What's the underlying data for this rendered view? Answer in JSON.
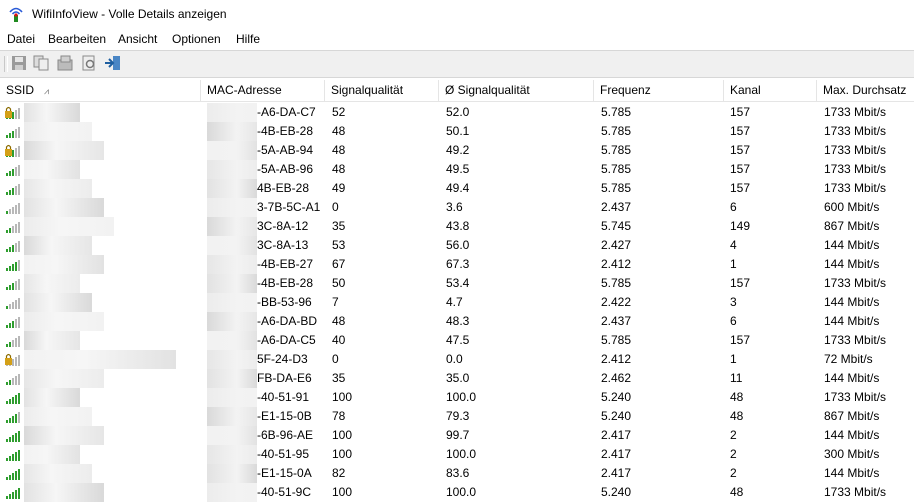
{
  "window": {
    "app_name": "WifiInfoView",
    "title_suffix": " - Volle Details anzeigen"
  },
  "menu": [
    "Datei",
    "Bearbeiten",
    "Ansicht",
    "Optionen",
    "Hilfe"
  ],
  "toolbar": [
    "save-icon",
    "copy-icon",
    "properties-icon",
    "find-icon",
    "exit-icon"
  ],
  "columns": [
    "SSID",
    "MAC-Adresse",
    "Signalqualität",
    "Ø Signalqualität",
    "Frequenz",
    "Kanal",
    "Max. Durchsatz"
  ],
  "rows": [
    {
      "mac": "-A6-DA-C7",
      "sig": "52",
      "avg": "52.0",
      "freq": "5.785",
      "ch": "157",
      "rate": "1733 Mbit/s",
      "lock": true,
      "bars": 3
    },
    {
      "mac": "-4B-EB-28",
      "sig": "48",
      "avg": "50.1",
      "freq": "5.785",
      "ch": "157",
      "rate": "1733 Mbit/s",
      "lock": false,
      "bars": 3
    },
    {
      "mac": "-5A-AB-94",
      "sig": "48",
      "avg": "49.2",
      "freq": "5.785",
      "ch": "157",
      "rate": "1733 Mbit/s",
      "lock": true,
      "bars": 3
    },
    {
      "mac": "-5A-AB-96",
      "sig": "48",
      "avg": "49.5",
      "freq": "5.785",
      "ch": "157",
      "rate": "1733 Mbit/s",
      "lock": false,
      "bars": 3
    },
    {
      "mac": "4B-EB-28",
      "sig": "49",
      "avg": "49.4",
      "freq": "5.785",
      "ch": "157",
      "rate": "1733 Mbit/s",
      "lock": false,
      "bars": 3
    },
    {
      "mac": "3-7B-5C-A1",
      "sig": "0",
      "avg": "3.6",
      "freq": "2.437",
      "ch": "6",
      "rate": "600 Mbit/s",
      "lock": false,
      "bars": 1
    },
    {
      "mac": "3C-8A-12",
      "sig": "35",
      "avg": "43.8",
      "freq": "5.745",
      "ch": "149",
      "rate": "867 Mbit/s",
      "lock": false,
      "bars": 2
    },
    {
      "mac": "3C-8A-13",
      "sig": "53",
      "avg": "56.0",
      "freq": "2.427",
      "ch": "4",
      "rate": "144 Mbit/s",
      "lock": false,
      "bars": 3
    },
    {
      "mac": "-4B-EB-27",
      "sig": "67",
      "avg": "67.3",
      "freq": "2.412",
      "ch": "1",
      "rate": "144 Mbit/s",
      "lock": false,
      "bars": 4
    },
    {
      "mac": "-4B-EB-28",
      "sig": "50",
      "avg": "53.4",
      "freq": "5.785",
      "ch": "157",
      "rate": "1733 Mbit/s",
      "lock": false,
      "bars": 3
    },
    {
      "mac": "-BB-53-96",
      "sig": "7",
      "avg": "4.7",
      "freq": "2.422",
      "ch": "3",
      "rate": "144 Mbit/s",
      "lock": false,
      "bars": 1
    },
    {
      "mac": "-A6-DA-BD",
      "sig": "48",
      "avg": "48.3",
      "freq": "2.437",
      "ch": "6",
      "rate": "144 Mbit/s",
      "lock": false,
      "bars": 3
    },
    {
      "mac": "-A6-DA-C5",
      "sig": "40",
      "avg": "47.5",
      "freq": "5.785",
      "ch": "157",
      "rate": "1733 Mbit/s",
      "lock": false,
      "bars": 2
    },
    {
      "mac": "5F-24-D3",
      "sig": "0",
      "avg": "0.0",
      "freq": "2.412",
      "ch": "1",
      "rate": "72 Mbit/s",
      "lock": true,
      "bars": 0
    },
    {
      "mac": "FB-DA-E6",
      "sig": "35",
      "avg": "35.0",
      "freq": "2.462",
      "ch": "11",
      "rate": "144 Mbit/s",
      "lock": false,
      "bars": 2
    },
    {
      "mac": "-40-51-91",
      "sig": "100",
      "avg": "100.0",
      "freq": "5.240",
      "ch": "48",
      "rate": "1733 Mbit/s",
      "lock": false,
      "bars": 5
    },
    {
      "mac": "-E1-15-0B",
      "sig": "78",
      "avg": "79.3",
      "freq": "5.240",
      "ch": "48",
      "rate": "867 Mbit/s",
      "lock": false,
      "bars": 4
    },
    {
      "mac": "-6B-96-AE",
      "sig": "100",
      "avg": "99.7",
      "freq": "2.417",
      "ch": "2",
      "rate": "144 Mbit/s",
      "lock": false,
      "bars": 5
    },
    {
      "mac": "-40-51-95",
      "sig": "100",
      "avg": "100.0",
      "freq": "2.417",
      "ch": "2",
      "rate": "300 Mbit/s",
      "lock": false,
      "bars": 5
    },
    {
      "mac": "-E1-15-0A",
      "sig": "82",
      "avg": "83.6",
      "freq": "2.417",
      "ch": "2",
      "rate": "144 Mbit/s",
      "lock": false,
      "bars": 5
    },
    {
      "mac": "-40-51-9C",
      "sig": "100",
      "avg": "100.0",
      "freq": "5.240",
      "ch": "48",
      "rate": "1733 Mbit/s",
      "lock": false,
      "bars": 5
    }
  ],
  "colors": {
    "signal": "#2e9d2e",
    "signal_off": "#b8b8b8",
    "lock": "#d4a017"
  }
}
